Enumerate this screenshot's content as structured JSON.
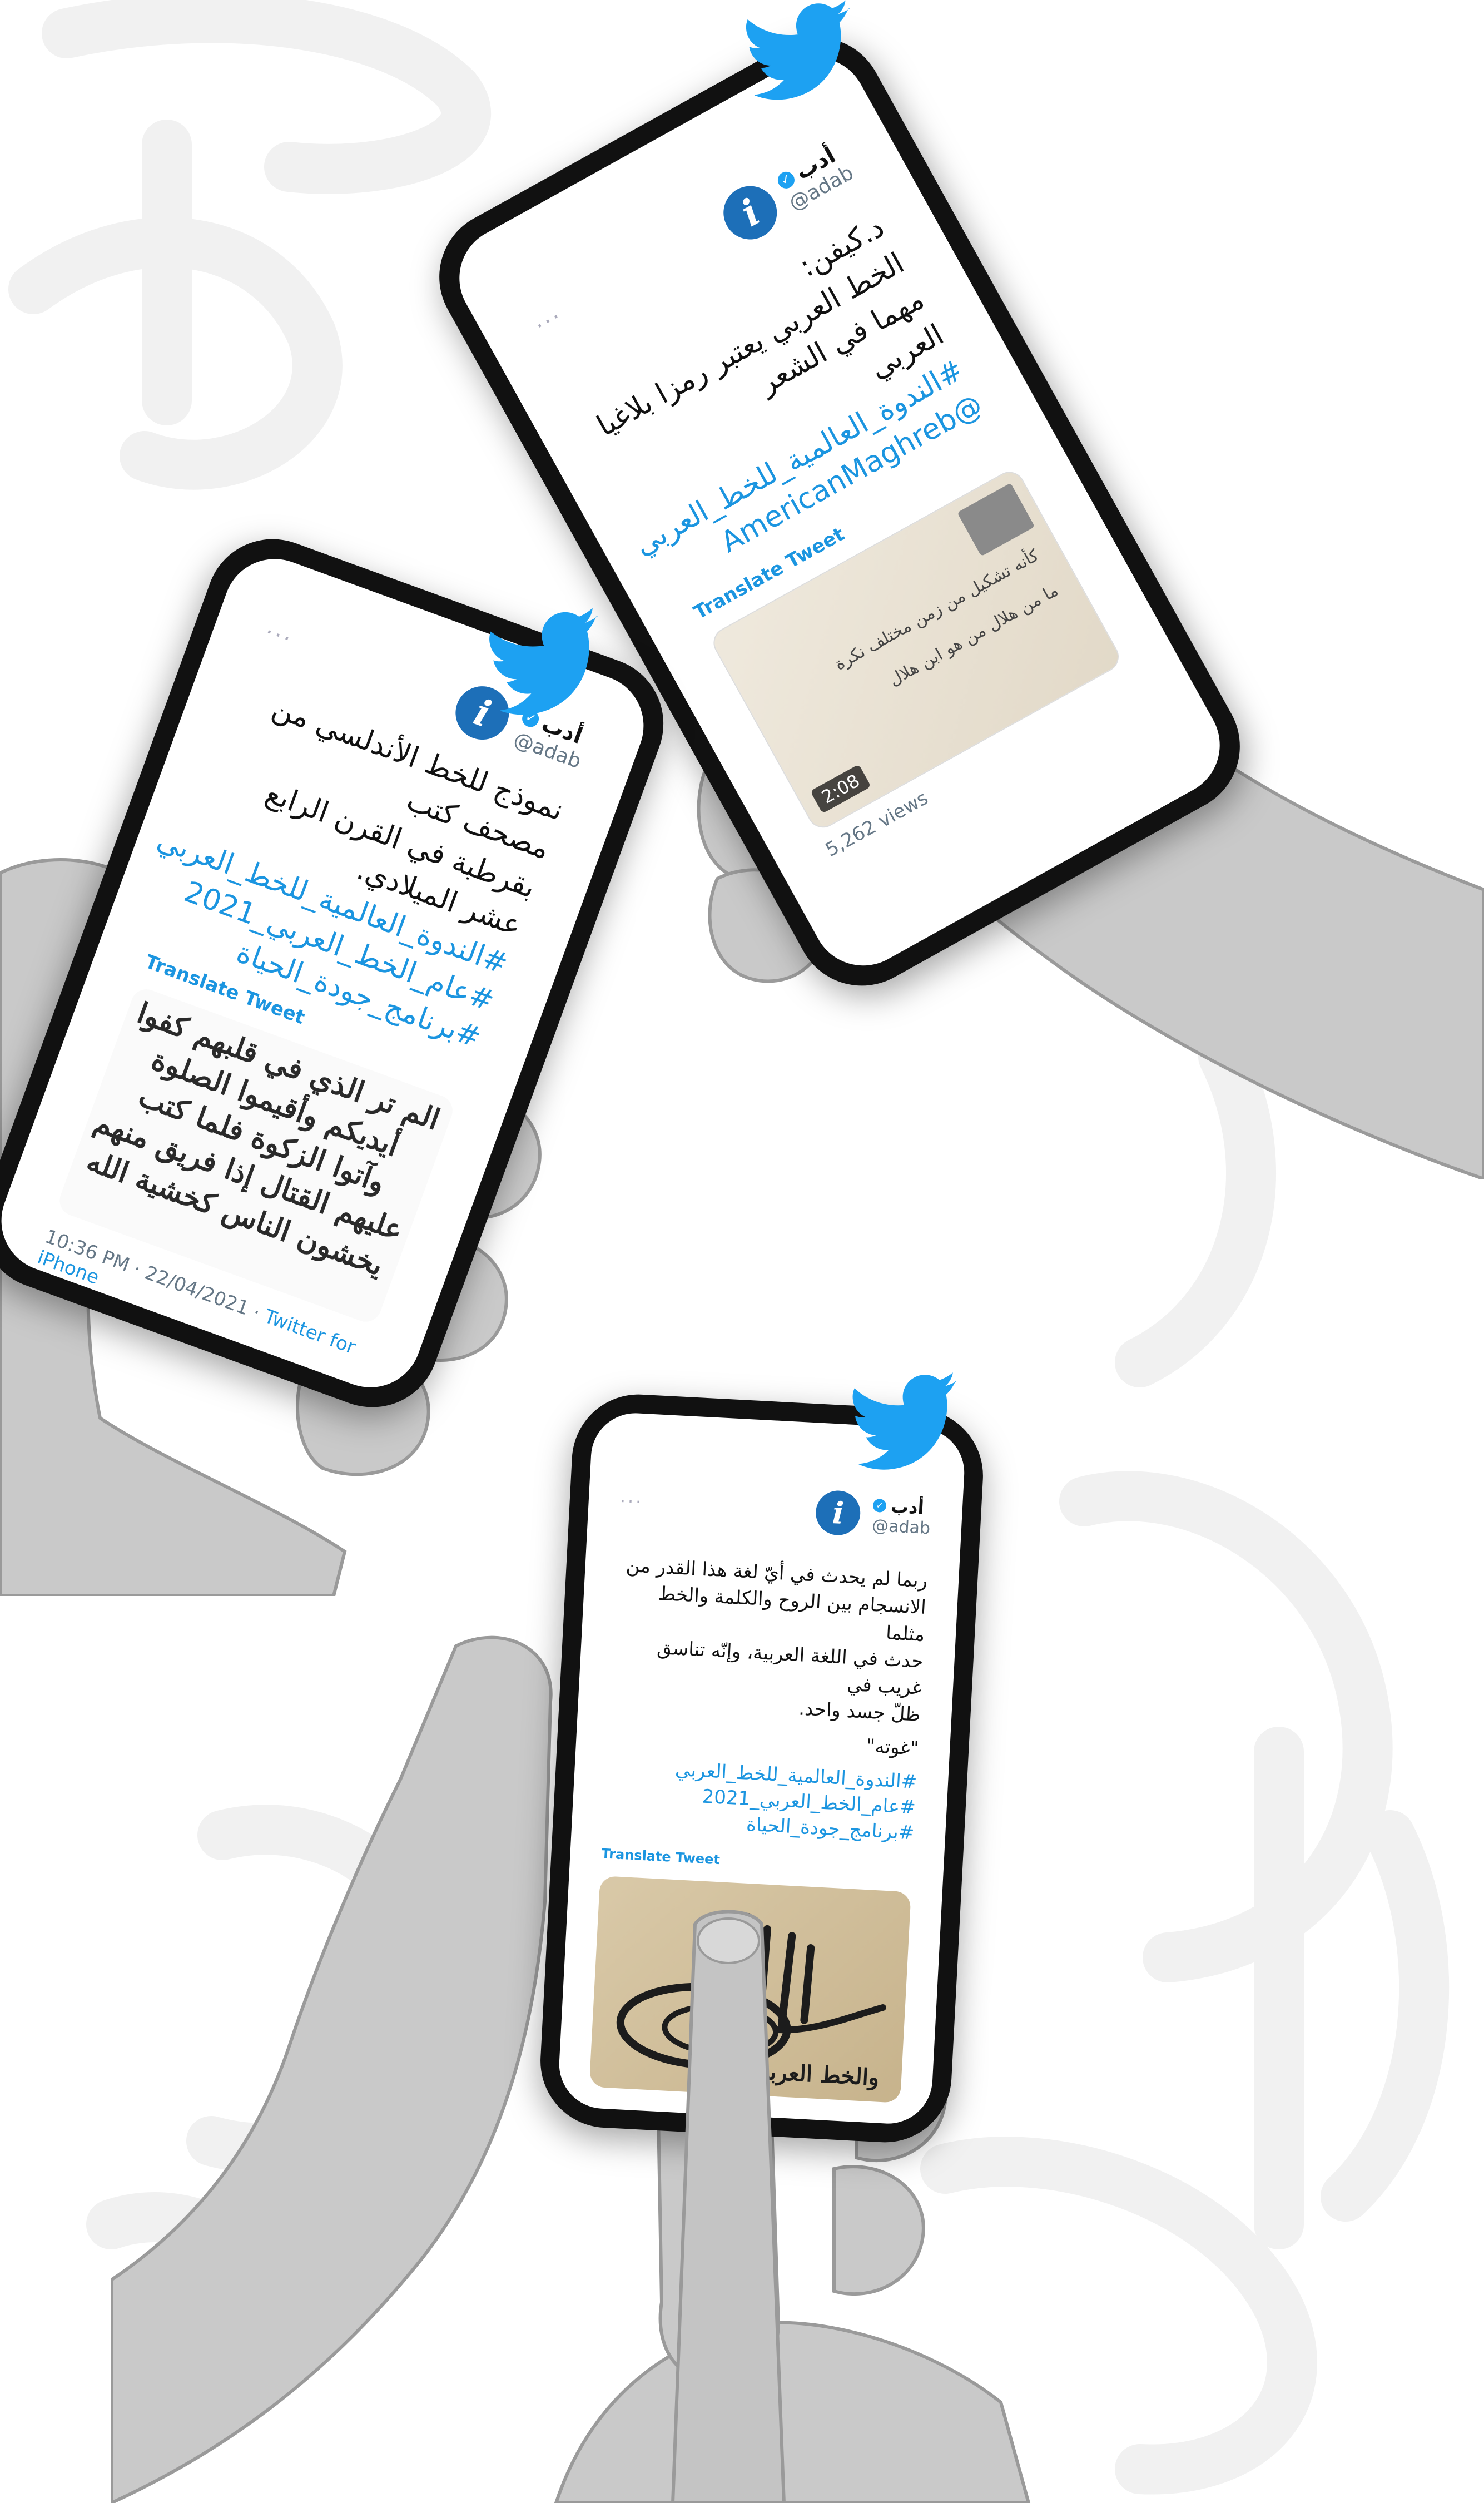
{
  "colors": {
    "twitter_blue": "#1da1f2",
    "link_blue": "#1b95e0",
    "avatar_blue": "#1d6fb8",
    "phone_frame": "#111111",
    "calligraphy_bg": "#f1f1f1"
  },
  "phone_top": {
    "display_name": "أدب",
    "handle": "@adab",
    "text_lines": [
      "د.كيفن:",
      "الخط العربي يعتبر رمزا بلاغيا مهما في الشعر",
      "العربي"
    ],
    "hashtags": [
      "#الندوة_العالمية_للخط_العربي",
      "@AmericanMaghreb"
    ],
    "translate": "Translate Tweet",
    "video_duration": "2:08",
    "views": "5,262 views",
    "avatar_letter": "i",
    "video_caption_lines": [
      "كأنه تشكيل من زمن مختلف نكرة",
      "ما من هلال من هو ابن هلال"
    ]
  },
  "phone_left": {
    "display_name": "أدب",
    "handle": "@adab",
    "text_lines": [
      "نموذج للخط الأندلسي من مصحف كتب",
      "بقرطبة في القرن الرابع عشر الميلادي."
    ],
    "hashtags": [
      "#الندوة_العالمية_للخط_العربي",
      "#عام_الخط_العربي_2021",
      "#برنامج_جودة_الحياة"
    ],
    "translate": "Translate Tweet",
    "timestamp": "10:36 PM · 22/04/2021 · ",
    "source": "Twitter for iPhone",
    "avatar_letter": "i",
    "calligraphy_lines": [
      "الم تر الذي في قلبهم كفوا",
      "أيديكم وأقيموا الصلوة",
      "وآتوا الزكوة فلما كتب",
      "عليهم القتال إذا فريق منهم",
      "يخشون الناس كخشية الله"
    ]
  },
  "phone_bottom": {
    "display_name": "أدب",
    "handle": "@adab",
    "text_lines": [
      "ربما لم يحدث في أيّ لغة هذا القدر من",
      "الانسجام بين الروح والكلمة والخط مثلما",
      "حدث في اللغة العربية، وإنّه تناسق غريب في",
      "ظلّ جسد واحد."
    ],
    "quote_author": "\"غوته\"",
    "hashtags": [
      "#الندوة_العالمية_للخط_العربي",
      "#عام_الخط_العربي_2021",
      "#برنامج_جودة_الحياة"
    ],
    "translate": "Translate Tweet",
    "avatar_letter": "i",
    "tughra_text": "والخط العربي"
  },
  "icons": [
    "twitter-bird-icon",
    "verified-icon",
    "more-icon"
  ],
  "more_glyph": "···",
  "verified_glyph": "✓"
}
